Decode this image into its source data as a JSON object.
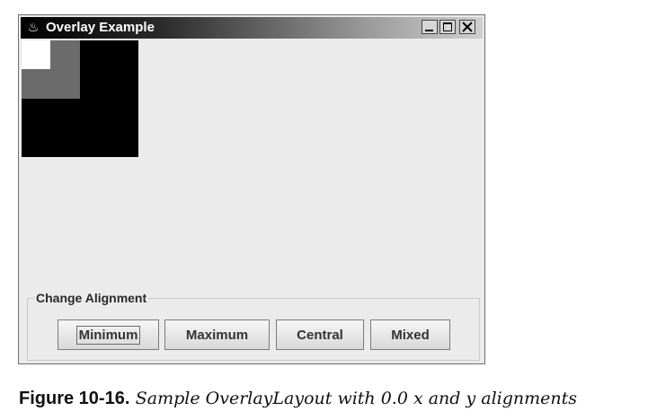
{
  "window": {
    "title": "Overlay Example",
    "icon": "java-cup-icon",
    "controls": [
      "minimize-icon",
      "maximize-icon",
      "close-icon"
    ]
  },
  "overlay": {
    "components": [
      "black-square",
      "gray-square",
      "white-square"
    ],
    "alignment_x": 0.0,
    "alignment_y": 0.0,
    "colors": {
      "large": "#000000",
      "medium": "#6b6b6b",
      "small": "#ffffff"
    }
  },
  "group": {
    "title": "Change Alignment",
    "buttons": [
      "Minimum",
      "Maximum",
      "Central",
      "Mixed"
    ],
    "focused": "Minimum"
  },
  "caption": {
    "label": "Figure 10-16.",
    "text": "Sample OverlayLayout with 0.0 x and y alignments"
  }
}
